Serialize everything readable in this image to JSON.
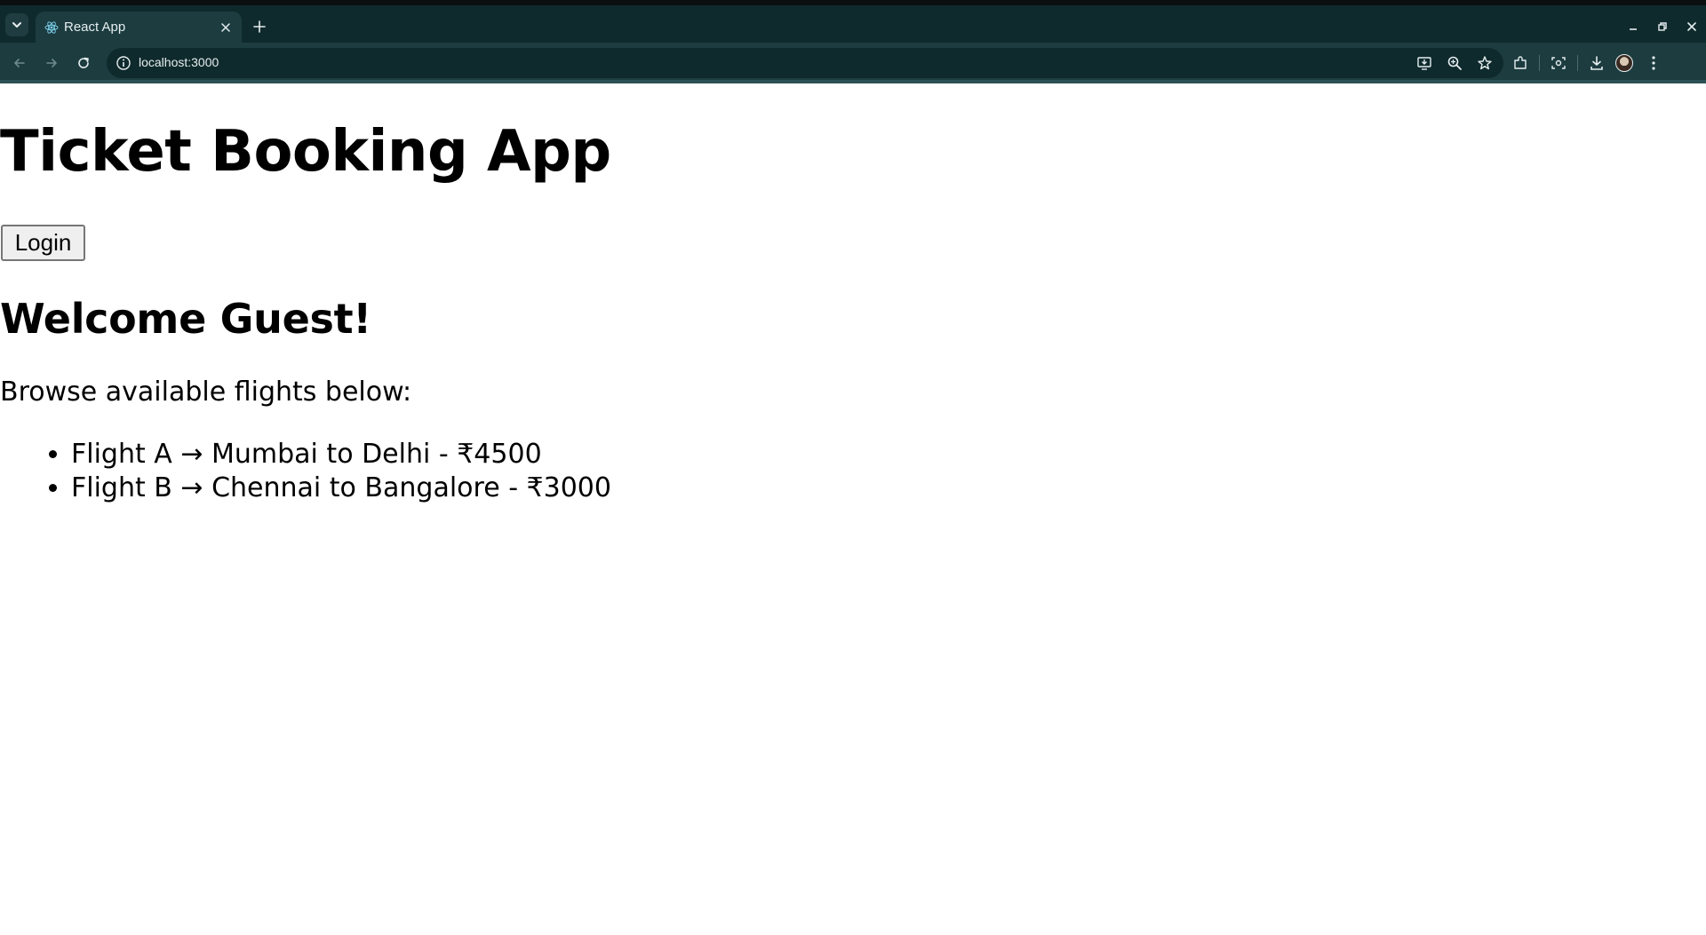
{
  "browser": {
    "tab": {
      "title": "React App"
    },
    "address_bar": {
      "url": "localhost:3000"
    },
    "colors": {
      "frame": "#0f2a2c",
      "toolbar": "#1c3c3f"
    }
  },
  "page": {
    "title": "Ticket Booking App",
    "login_button": "Login",
    "welcome": "Welcome Guest!",
    "intro": "Browse available flights below:",
    "flights": [
      "Flight A → Mumbai to Delhi - ₹4500",
      "Flight B → Chennai to Bangalore - ₹3000"
    ]
  }
}
